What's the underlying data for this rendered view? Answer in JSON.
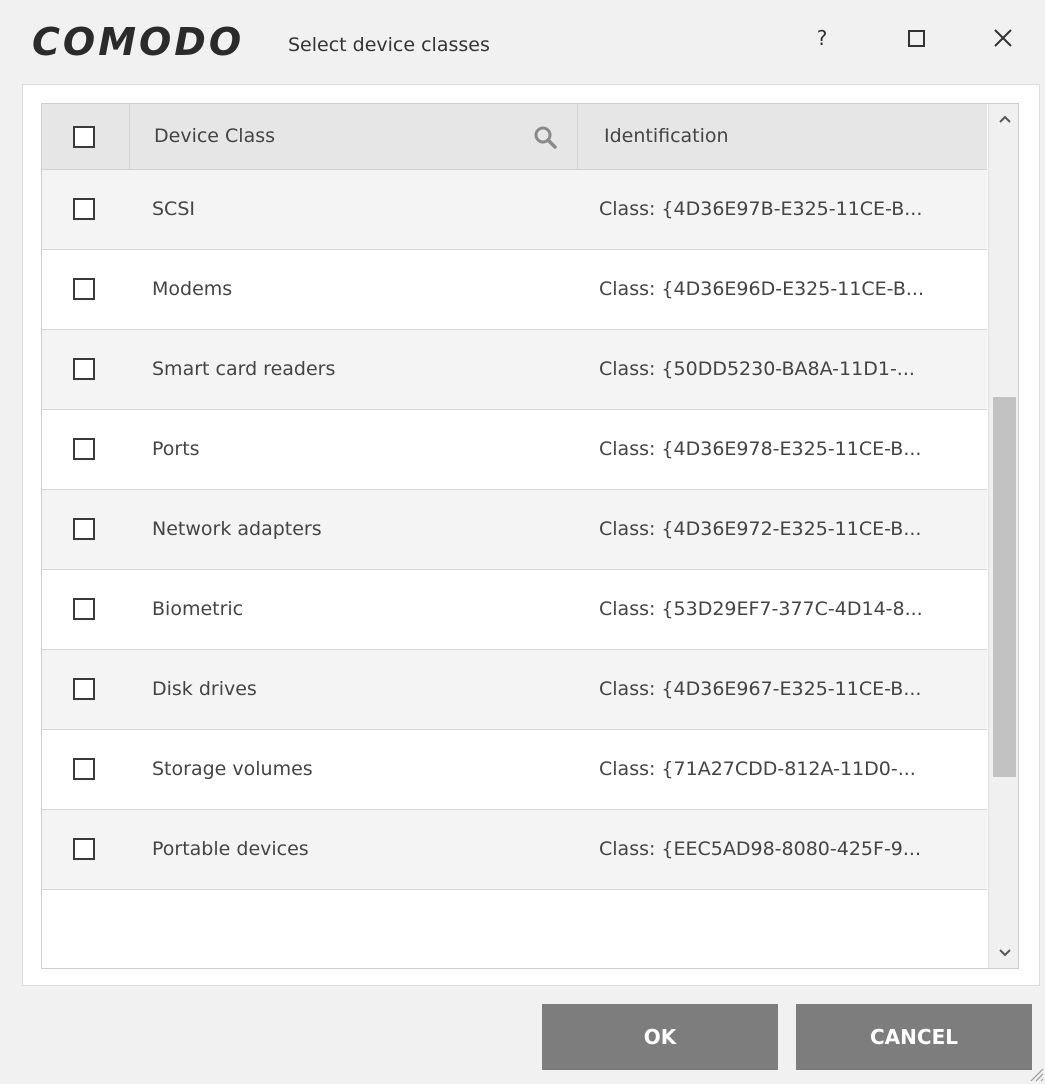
{
  "window": {
    "logo": "COMODO",
    "title": "Select device classes",
    "help_label": "?"
  },
  "table": {
    "columns": {
      "device_class": "Device Class",
      "identification": "Identification"
    },
    "rows": [
      {
        "device_class": "SCSI",
        "identification": "Class: {4D36E97B-E325-11CE-B...",
        "checked": false
      },
      {
        "device_class": "Modems",
        "identification": "Class: {4D36E96D-E325-11CE-B...",
        "checked": false
      },
      {
        "device_class": "Smart card readers",
        "identification": "Class: {50DD5230-BA8A-11D1-...",
        "checked": false
      },
      {
        "device_class": "Ports",
        "identification": "Class: {4D36E978-E325-11CE-B...",
        "checked": false
      },
      {
        "device_class": "Network adapters",
        "identification": "Class: {4D36E972-E325-11CE-B...",
        "checked": false
      },
      {
        "device_class": "Biometric",
        "identification": "Class: {53D29EF7-377C-4D14-8...",
        "checked": false
      },
      {
        "device_class": "Disk drives",
        "identification": "Class: {4D36E967-E325-11CE-B...",
        "checked": false
      },
      {
        "device_class": "Storage volumes",
        "identification": "Class: {71A27CDD-812A-11D0-...",
        "checked": false
      },
      {
        "device_class": "Portable devices",
        "identification": "Class: {EEC5AD98-8080-425F-9...",
        "checked": false
      }
    ],
    "select_all_checked": false,
    "scroll_position": 0.62
  },
  "buttons": {
    "ok": "OK",
    "cancel": "CANCEL"
  },
  "icons": [
    "search-icon",
    "close-icon",
    "maximize-icon",
    "chevron-up-icon",
    "chevron-down-icon",
    "resize-grip-icon"
  ],
  "colors": {
    "button_bg": "#7d7d7d",
    "header_bg": "#e6e6e6",
    "dialog_bg": "#f1f1f1"
  }
}
